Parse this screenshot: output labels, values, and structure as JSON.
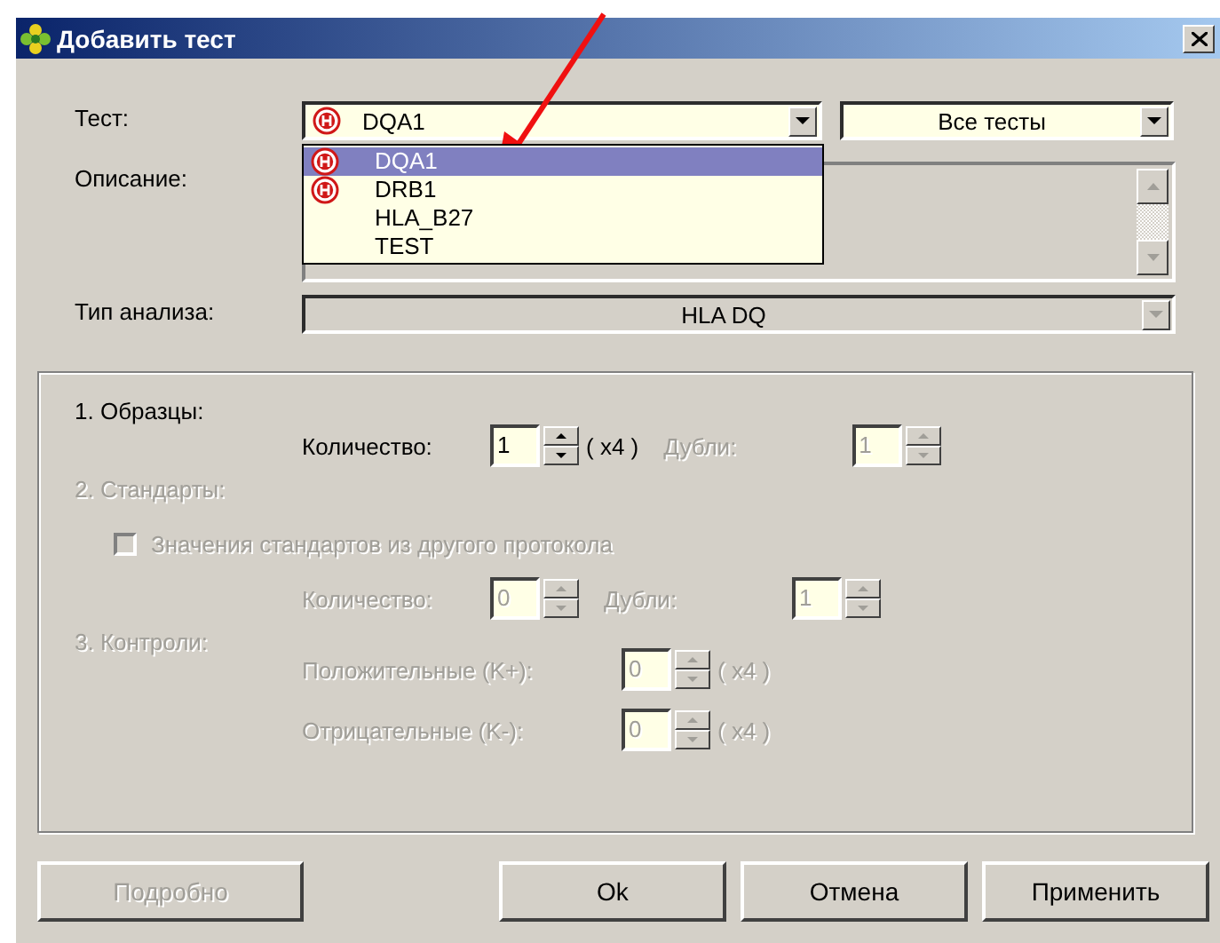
{
  "window": {
    "title": "Добавить тест"
  },
  "test": {
    "label": "Тест:",
    "value": "DQA1",
    "marked": true,
    "expanded": true,
    "options": [
      {
        "label": "DQA1",
        "marked": true,
        "selected": true
      },
      {
        "label": "DRB1",
        "marked": true,
        "selected": false
      },
      {
        "label": "HLA_B27",
        "marked": false,
        "selected": false
      },
      {
        "label": "TEST",
        "marked": false,
        "selected": false
      }
    ]
  },
  "filter": {
    "value": "Все тесты"
  },
  "description": {
    "label": "Описание:"
  },
  "analysis_type": {
    "label": "Тип анализа:",
    "value": "HLA DQ",
    "disabled": true
  },
  "sections": [
    {
      "title": "1. Образцы:",
      "disabled": false,
      "rows": [
        {
          "kind": "pair",
          "spinners": [
            {
              "label": "Количество:",
              "value": "1",
              "suffix": "( x4 )",
              "disabled": false
            },
            {
              "label": "Дубли:",
              "value": "1",
              "disabled": true
            }
          ]
        }
      ]
    },
    {
      "title": "2. Стандарты:",
      "disabled": true,
      "rows": [
        {
          "kind": "checkbox",
          "label": "Значения стандартов из другого протокола",
          "checked": false,
          "disabled": true
        },
        {
          "kind": "pair",
          "spinners": [
            {
              "label": "Количество:",
              "value": "0",
              "disabled": true
            },
            {
              "label": "Дубли:",
              "value": "1",
              "disabled": true
            }
          ]
        }
      ]
    },
    {
      "title": "3. Контроли:",
      "disabled": true,
      "rows": [
        {
          "kind": "single",
          "spinners": [
            {
              "label": "Положительные (K+):",
              "value": "0",
              "suffix": "( x4 )",
              "disabled": true
            }
          ]
        },
        {
          "kind": "single",
          "spinners": [
            {
              "label": "Отрицательные (K-):",
              "value": "0",
              "suffix": "( x4 )",
              "disabled": true
            }
          ]
        }
      ]
    }
  ],
  "buttons": [
    {
      "label": "Подробно",
      "disabled": true
    },
    {
      "label": "Ok",
      "disabled": false
    },
    {
      "label": "Отмена",
      "disabled": false
    },
    {
      "label": "Применить",
      "disabled": false
    }
  ]
}
